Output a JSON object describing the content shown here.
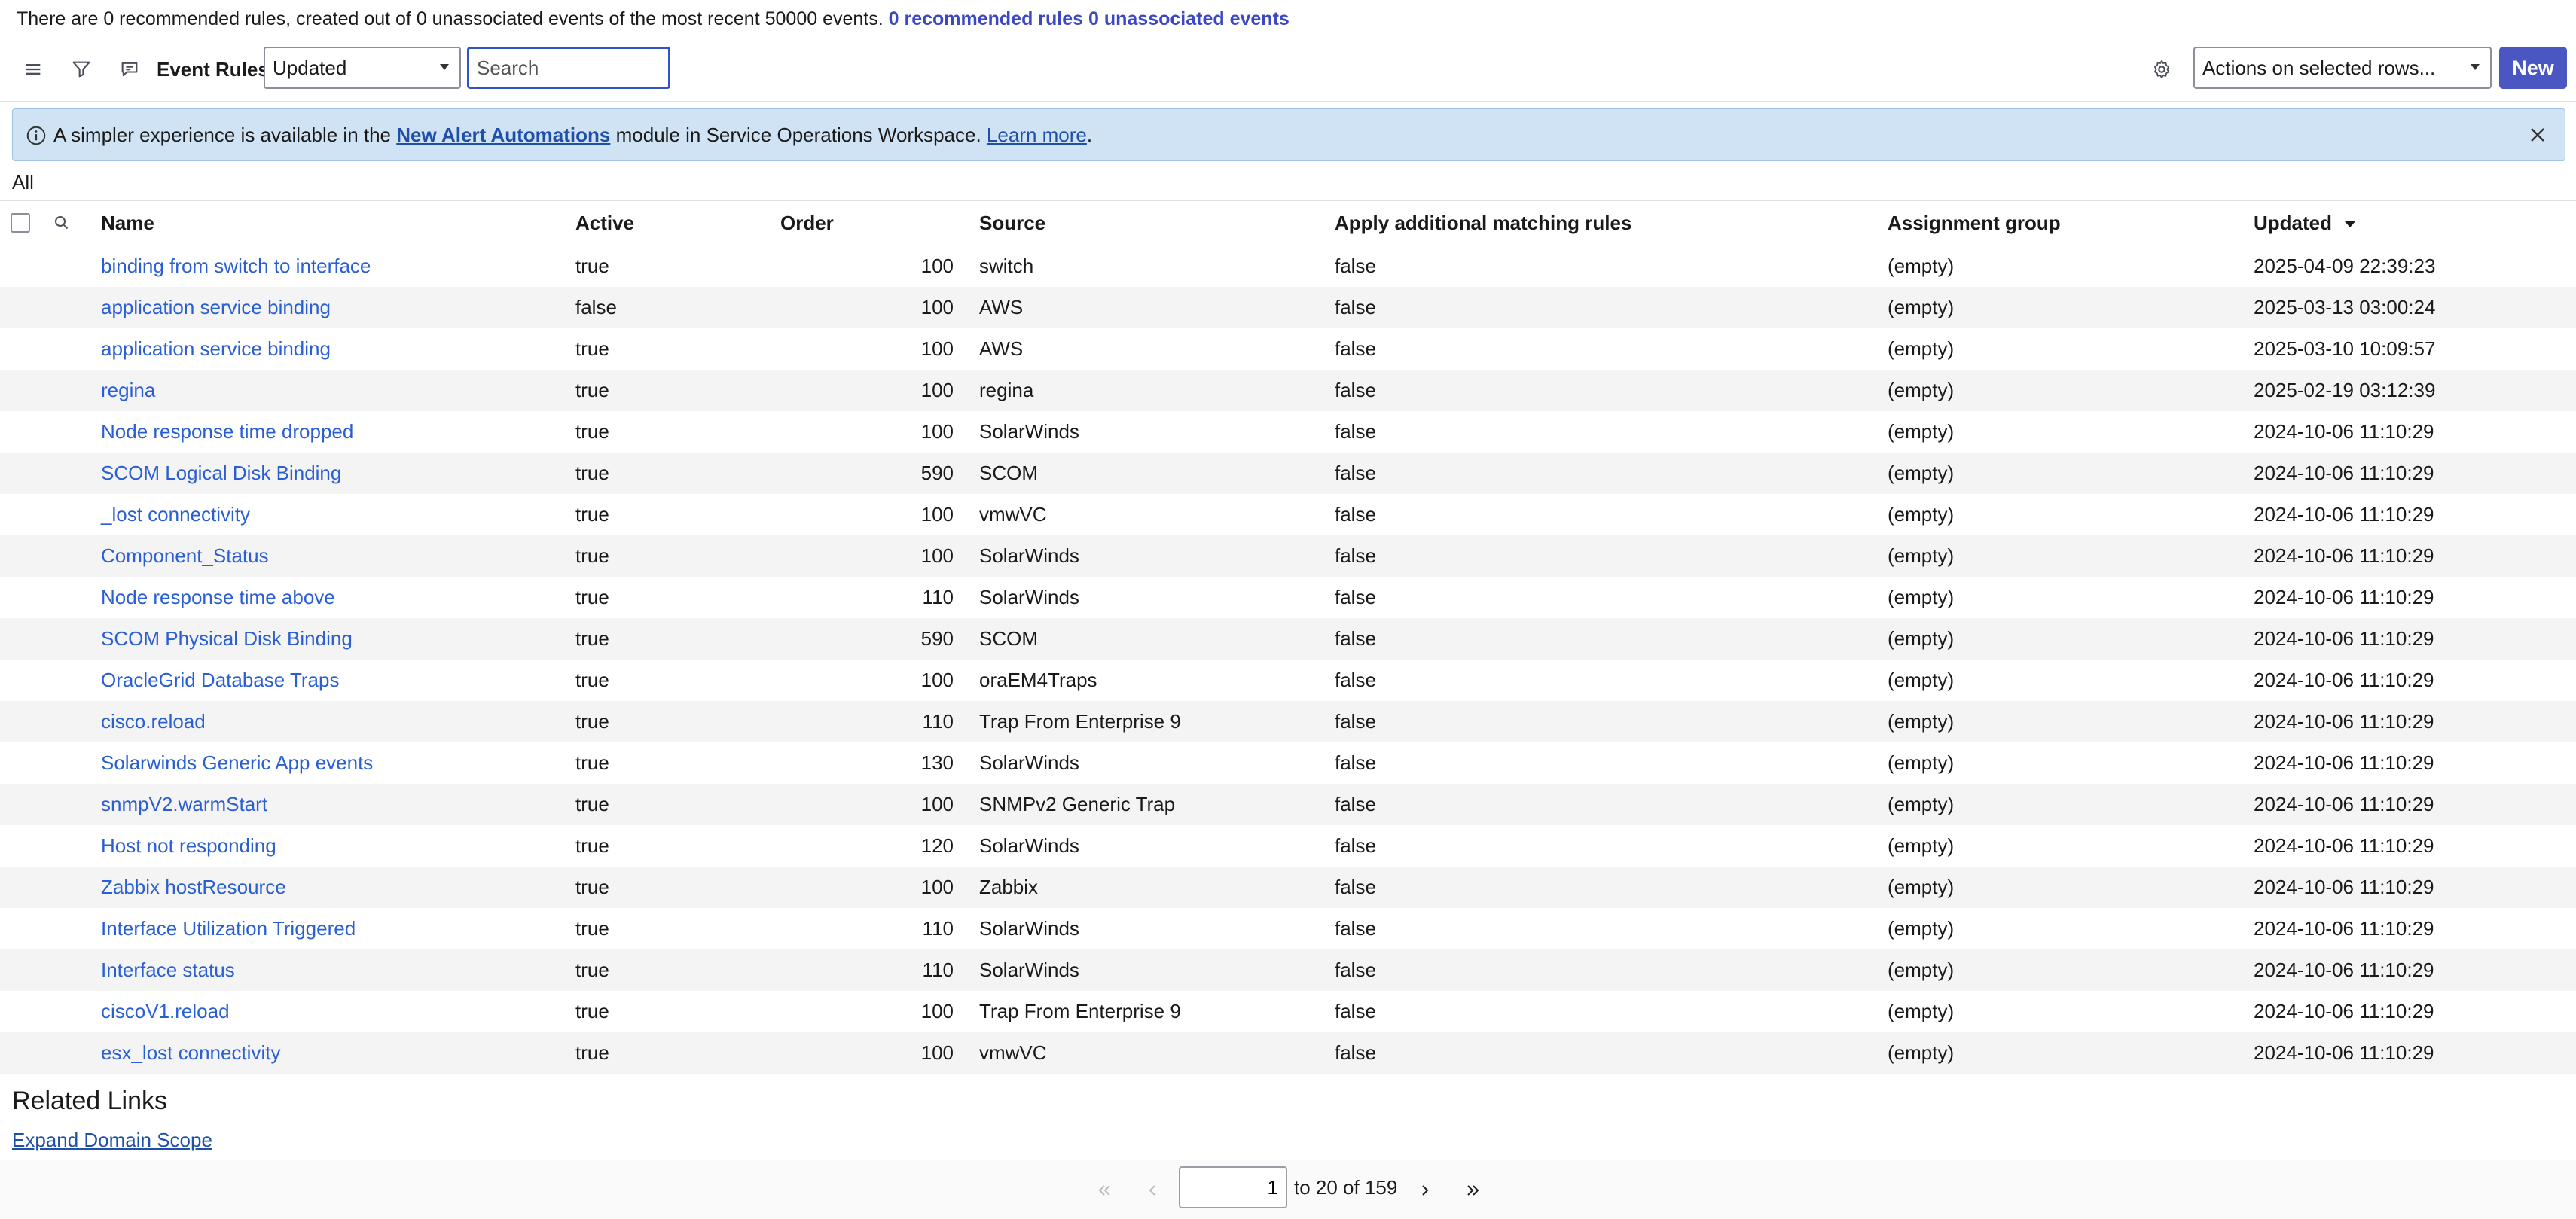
{
  "top_info": {
    "text": "There are 0 recommended rules, created out of 0 unassociated events of the most recent 50000 events.",
    "link_rules": "0 recommended rules",
    "link_events": "0 unassociated events"
  },
  "toolbar": {
    "title": "Event Rules",
    "sort_field": "Updated",
    "search_placeholder": "Search",
    "actions_label": "Actions on selected rows...",
    "new_label": "New",
    "icons": [
      "hamburger-menu-icon",
      "filter-icon",
      "comment-icon",
      "gear-icon"
    ]
  },
  "banner": {
    "text_before": "A simpler experience is available in the",
    "link": "New Alert Automations",
    "text_after": "module in Service Operations Workspace.",
    "learn_more": "Learn more",
    "period": "."
  },
  "list_label": "All",
  "table": {
    "columns": {
      "name": "Name",
      "active": "Active",
      "order": "Order",
      "source": "Source",
      "apply": "Apply additional matching rules",
      "group": "Assignment group",
      "updated": "Updated"
    },
    "sorted_column": "Updated",
    "sort_direction": "descending",
    "rows": [
      {
        "name": "binding from switch to interface",
        "active": "true",
        "order": "100",
        "source": "switch",
        "apply": "false",
        "group": "(empty)",
        "updated": "2025-04-09 22:39:23"
      },
      {
        "name": "application service binding",
        "active": "false",
        "order": "100",
        "source": "AWS",
        "apply": "false",
        "group": "(empty)",
        "updated": "2025-03-13 03:00:24"
      },
      {
        "name": "application service binding",
        "active": "true",
        "order": "100",
        "source": "AWS",
        "apply": "false",
        "group": "(empty)",
        "updated": "2025-03-10 10:09:57"
      },
      {
        "name": "regina",
        "active": "true",
        "order": "100",
        "source": "regina",
        "apply": "false",
        "group": "(empty)",
        "updated": "2025-02-19 03:12:39"
      },
      {
        "name": "Node response time dropped",
        "active": "true",
        "order": "100",
        "source": "SolarWinds",
        "apply": "false",
        "group": "(empty)",
        "updated": "2024-10-06 11:10:29"
      },
      {
        "name": "SCOM Logical Disk Binding",
        "active": "true",
        "order": "590",
        "source": "SCOM",
        "apply": "false",
        "group": "(empty)",
        "updated": "2024-10-06 11:10:29"
      },
      {
        "name": "_lost connectivity",
        "active": "true",
        "order": "100",
        "source": "vmwVC",
        "apply": "false",
        "group": "(empty)",
        "updated": "2024-10-06 11:10:29"
      },
      {
        "name": "Component_Status",
        "active": "true",
        "order": "100",
        "source": "SolarWinds",
        "apply": "false",
        "group": "(empty)",
        "updated": "2024-10-06 11:10:29"
      },
      {
        "name": "Node response time above",
        "active": "true",
        "order": "110",
        "source": "SolarWinds",
        "apply": "false",
        "group": "(empty)",
        "updated": "2024-10-06 11:10:29"
      },
      {
        "name": "SCOM Physical Disk Binding",
        "active": "true",
        "order": "590",
        "source": "SCOM",
        "apply": "false",
        "group": "(empty)",
        "updated": "2024-10-06 11:10:29"
      },
      {
        "name": "OracleGrid Database Traps",
        "active": "true",
        "order": "100",
        "source": "oraEM4Traps",
        "apply": "false",
        "group": "(empty)",
        "updated": "2024-10-06 11:10:29"
      },
      {
        "name": "cisco.reload",
        "active": "true",
        "order": "110",
        "source": "Trap From Enterprise 9",
        "apply": "false",
        "group": "(empty)",
        "updated": "2024-10-06 11:10:29"
      },
      {
        "name": "Solarwinds Generic App events",
        "active": "true",
        "order": "130",
        "source": "SolarWinds",
        "apply": "false",
        "group": "(empty)",
        "updated": "2024-10-06 11:10:29"
      },
      {
        "name": "snmpV2.warmStart",
        "active": "true",
        "order": "100",
        "source": "SNMPv2 Generic Trap",
        "apply": "false",
        "group": "(empty)",
        "updated": "2024-10-06 11:10:29"
      },
      {
        "name": "Host not responding",
        "active": "true",
        "order": "120",
        "source": "SolarWinds",
        "apply": "false",
        "group": "(empty)",
        "updated": "2024-10-06 11:10:29"
      },
      {
        "name": "Zabbix hostResource",
        "active": "true",
        "order": "100",
        "source": "Zabbix",
        "apply": "false",
        "group": "(empty)",
        "updated": "2024-10-06 11:10:29"
      },
      {
        "name": "Interface Utilization Triggered",
        "active": "true",
        "order": "110",
        "source": "SolarWinds",
        "apply": "false",
        "group": "(empty)",
        "updated": "2024-10-06 11:10:29"
      },
      {
        "name": "Interface status",
        "active": "true",
        "order": "110",
        "source": "SolarWinds",
        "apply": "false",
        "group": "(empty)",
        "updated": "2024-10-06 11:10:29"
      },
      {
        "name": "ciscoV1.reload",
        "active": "true",
        "order": "100",
        "source": "Trap From Enterprise 9",
        "apply": "false",
        "group": "(empty)",
        "updated": "2024-10-06 11:10:29"
      },
      {
        "name": "esx_lost connectivity",
        "active": "true",
        "order": "100",
        "source": "vmwVC",
        "apply": "false",
        "group": "(empty)",
        "updated": "2024-10-06 11:10:29"
      }
    ]
  },
  "related": {
    "heading": "Related Links",
    "expand_link": "Expand Domain Scope"
  },
  "pager": {
    "page_value": "1",
    "range_text": "to 20 of 159"
  },
  "colors": {
    "link": "#2a5fd4",
    "primary_button": "#4a57c2",
    "banner_bg": "#cfe3f4",
    "search_focus": "#3153c4"
  }
}
